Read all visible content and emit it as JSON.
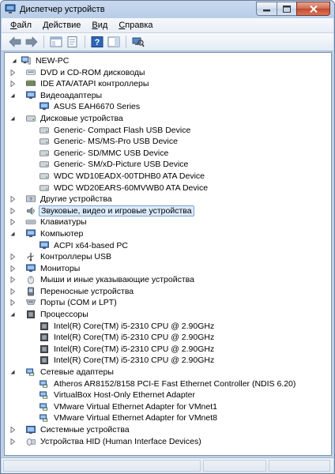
{
  "window": {
    "title": "Диспетчер устройств"
  },
  "menu": [
    {
      "label": "Файл",
      "key": "Ф",
      "rest": "айл"
    },
    {
      "label": "Действие",
      "key": "Д",
      "rest": "ействие"
    },
    {
      "label": "Вид",
      "key": "В",
      "rest": "ид"
    },
    {
      "label": "Справка",
      "key": "С",
      "rest": "правка"
    }
  ],
  "toolbar": [
    "back-icon",
    "forward-icon",
    "console-tree-icon",
    "properties-icon",
    "help-icon",
    "show-hide-icon",
    "scan-hardware-icon"
  ],
  "tree": [
    {
      "level": 0,
      "state": "expanded",
      "icon": "computer",
      "label": "NEW-PC"
    },
    {
      "level": 1,
      "state": "collapsed",
      "icon": "cdrom",
      "label": "DVD и CD-ROM дисководы"
    },
    {
      "level": 1,
      "state": "collapsed",
      "icon": "ide",
      "label": "IDE ATA/ATAPI контроллеры"
    },
    {
      "level": 1,
      "state": "expanded",
      "icon": "monitor",
      "label": "Видеоадаптеры"
    },
    {
      "level": 2,
      "state": "leaf",
      "icon": "monitor",
      "label": "ASUS EAH6670 Series"
    },
    {
      "level": 1,
      "state": "expanded",
      "icon": "disk",
      "label": "Дисковые устройства"
    },
    {
      "level": 2,
      "state": "leaf",
      "icon": "disk",
      "label": "Generic- Compact Flash USB Device"
    },
    {
      "level": 2,
      "state": "leaf",
      "icon": "disk",
      "label": "Generic- MS/MS-Pro USB Device"
    },
    {
      "level": 2,
      "state": "leaf",
      "icon": "disk",
      "label": "Generic- SD/MMC USB Device"
    },
    {
      "level": 2,
      "state": "leaf",
      "icon": "disk",
      "label": "Generic- SM/xD-Picture USB Device"
    },
    {
      "level": 2,
      "state": "leaf",
      "icon": "disk",
      "label": "WDC WD10EADX-00TDHB0 ATA Device"
    },
    {
      "level": 2,
      "state": "leaf",
      "icon": "disk",
      "label": "WDC WD20EARS-60MVWB0 ATA Device"
    },
    {
      "level": 1,
      "state": "collapsed",
      "icon": "other",
      "label": "Другие устройства"
    },
    {
      "level": 1,
      "state": "collapsed",
      "icon": "sound",
      "label": "Звуковые, видео и игровые устройства",
      "selected": true
    },
    {
      "level": 1,
      "state": "collapsed",
      "icon": "keyboard",
      "label": "Клавиатуры"
    },
    {
      "level": 1,
      "state": "expanded",
      "icon": "monitor",
      "label": "Компьютер"
    },
    {
      "level": 2,
      "state": "leaf",
      "icon": "monitor",
      "label": "ACPI x64-based PC"
    },
    {
      "level": 1,
      "state": "collapsed",
      "icon": "usb",
      "label": "Контроллеры USB"
    },
    {
      "level": 1,
      "state": "collapsed",
      "icon": "monitor",
      "label": "Мониторы"
    },
    {
      "level": 1,
      "state": "collapsed",
      "icon": "mouse",
      "label": "Мыши и иные указывающие устройства"
    },
    {
      "level": 1,
      "state": "collapsed",
      "icon": "portable",
      "label": "Переносные устройства"
    },
    {
      "level": 1,
      "state": "collapsed",
      "icon": "port",
      "label": "Порты (COM и LPT)"
    },
    {
      "level": 1,
      "state": "expanded",
      "icon": "cpu",
      "label": "Процессоры"
    },
    {
      "level": 2,
      "state": "leaf",
      "icon": "cpu",
      "label": "Intel(R) Core(TM) i5-2310 CPU @ 2.90GHz"
    },
    {
      "level": 2,
      "state": "leaf",
      "icon": "cpu",
      "label": "Intel(R) Core(TM) i5-2310 CPU @ 2.90GHz"
    },
    {
      "level": 2,
      "state": "leaf",
      "icon": "cpu",
      "label": "Intel(R) Core(TM) i5-2310 CPU @ 2.90GHz"
    },
    {
      "level": 2,
      "state": "leaf",
      "icon": "cpu",
      "label": "Intel(R) Core(TM) i5-2310 CPU @ 2.90GHz"
    },
    {
      "level": 1,
      "state": "expanded",
      "icon": "network",
      "label": "Сетевые адаптеры"
    },
    {
      "level": 2,
      "state": "leaf",
      "icon": "network",
      "label": "Atheros AR8152/8158 PCI-E Fast Ethernet Controller (NDIS 6.20)"
    },
    {
      "level": 2,
      "state": "leaf",
      "icon": "network",
      "label": "VirtualBox Host-Only Ethernet Adapter"
    },
    {
      "level": 2,
      "state": "leaf",
      "icon": "network",
      "label": "VMware Virtual Ethernet Adapter for VMnet1"
    },
    {
      "level": 2,
      "state": "leaf",
      "icon": "network",
      "label": "VMware Virtual Ethernet Adapter for VMnet8"
    },
    {
      "level": 1,
      "state": "collapsed",
      "icon": "system",
      "label": "Системные устройства"
    },
    {
      "level": 1,
      "state": "collapsed",
      "icon": "hid",
      "label": "Устройства HID (Human Interface Devices)"
    }
  ]
}
